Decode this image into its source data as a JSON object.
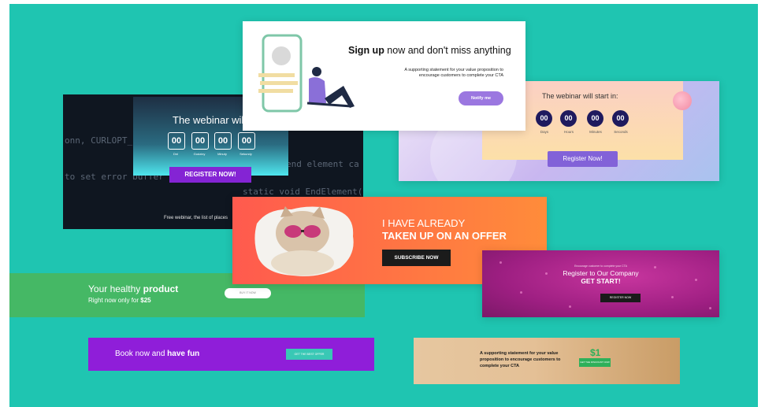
{
  "dark_webinar": {
    "code_lines": [
      "onn, CURLOPT_E",
      "to set error buffer",
      "end element ca",
      "static void EndElement(vo"
    ],
    "title": "The webinar will start i",
    "countdown": [
      {
        "value": "00",
        "label": "Dni"
      },
      {
        "value": "00",
        "label": "Godziny"
      },
      {
        "value": "00",
        "label": "Minuty"
      },
      {
        "value": "00",
        "label": "Sekundy"
      }
    ],
    "register_label": "REGISTER NOW!",
    "footnote": "Free webinar, the list of places"
  },
  "signup": {
    "title_bold": "Sign up",
    "title_rest": " now and don't miss anything",
    "support_line1": "A supporting statement for your value proposition to",
    "support_line2": "encourage customers to complete your CTA",
    "button_label": "Notify me"
  },
  "purple_webinar": {
    "title": "The webinar will start in:",
    "countdown": [
      {
        "value": "00",
        "label": "Days"
      },
      {
        "value": "00",
        "label": "Hours"
      },
      {
        "value": "00",
        "label": "Minutes"
      },
      {
        "value": "00",
        "label": "Seconds"
      }
    ],
    "register_label": "Register Now!"
  },
  "offer": {
    "line1": "I HAVE ALREADY",
    "line2": "TAKEN UP ON AN OFFER",
    "button_label": "SUBSCRIBE NOW"
  },
  "healthy": {
    "title_regular": "Your healthy ",
    "title_bold": "product",
    "sub_regular": "Right now only for ",
    "sub_price": "$25",
    "button_label": "BUY IT NOW"
  },
  "company": {
    "tiny_text": "Encourage customer to complete your CTA",
    "register": "Register to Our Company",
    "get_start": "GET START!",
    "button_label": "REGISTER NOW"
  },
  "book": {
    "text_regular": "Book now and ",
    "text_bold": "have fun",
    "button_label": "GET THE BEST OFFER"
  },
  "dollar": {
    "text": "A supporting statement for your value proposition to encourage customers to complete your CTA",
    "price": "$1",
    "button_label": "GET THE DISCOUNT NOW"
  }
}
